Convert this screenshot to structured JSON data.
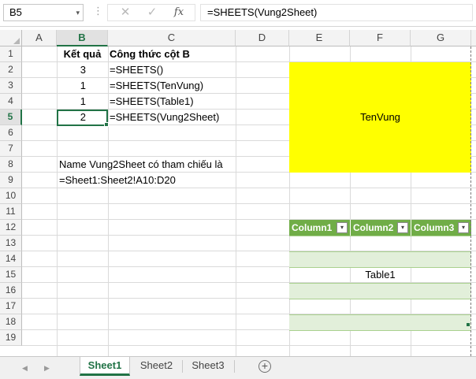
{
  "formula_bar": {
    "name_box": "B5",
    "name_box_dropdown": "▾",
    "dots": "⋮",
    "cancel_glyph": "✕",
    "enter_glyph": "✓",
    "fx_glyph": "fx",
    "formula": "=SHEETS(Vung2Sheet)"
  },
  "grid": {
    "columns": [
      "A",
      "B",
      "C",
      "D",
      "E",
      "F",
      "G"
    ],
    "rows": [
      "1",
      "2",
      "3",
      "4",
      "5",
      "6",
      "7",
      "8",
      "9",
      "10",
      "11",
      "12",
      "13",
      "14",
      "15",
      "16",
      "17",
      "18",
      "19"
    ],
    "selected_cell": "B5"
  },
  "cells": {
    "b1": "Kết quả",
    "c1": "Công thức cột B",
    "b2": "3",
    "c2": "=SHEETS()",
    "b3": "1",
    "c3": "=SHEETS(TenVung)",
    "b4": "1",
    "c4": "=SHEETS(Table1)",
    "b5": "2",
    "c5": "=SHEETS(Vung2Sheet)",
    "b8": "Name Vung2Sheet có tham chiếu là",
    "b9": "=Sheet1:Sheet2!A10:D20"
  },
  "named_range": {
    "label": "TenVung",
    "color": "#ffff00"
  },
  "table": {
    "headers": [
      "Column1",
      "Column2",
      "Column3"
    ],
    "dropdown_glyph": "▾",
    "label": "Table1",
    "header_color": "#70ad47",
    "band_color": "#e2efda"
  },
  "sheet_tabs": {
    "prev_glyph": "◀",
    "next_glyph": "▶",
    "tabs": [
      "Sheet1",
      "Sheet2",
      "Sheet3"
    ],
    "active": "Sheet1",
    "add_glyph": "+"
  },
  "colors": {
    "accent": "#217346"
  }
}
